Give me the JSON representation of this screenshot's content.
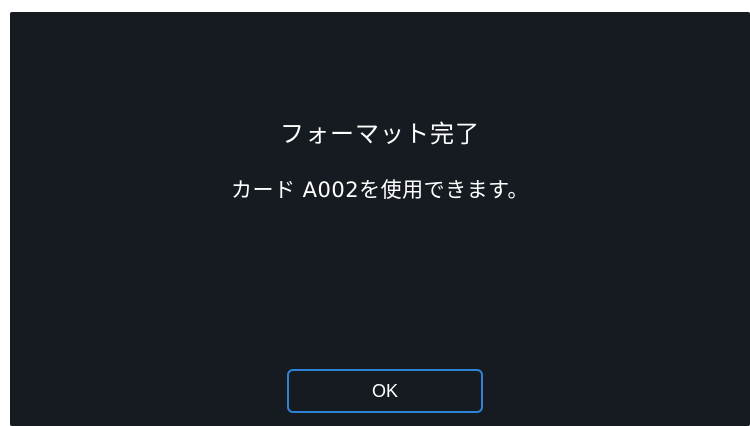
{
  "dialog": {
    "title": "フォーマット完了",
    "message": "カード A002を使用できます。",
    "ok_label": "OK"
  },
  "colors": {
    "background": "#161b22",
    "text": "#ffffff",
    "accent": "#2e83d6"
  }
}
